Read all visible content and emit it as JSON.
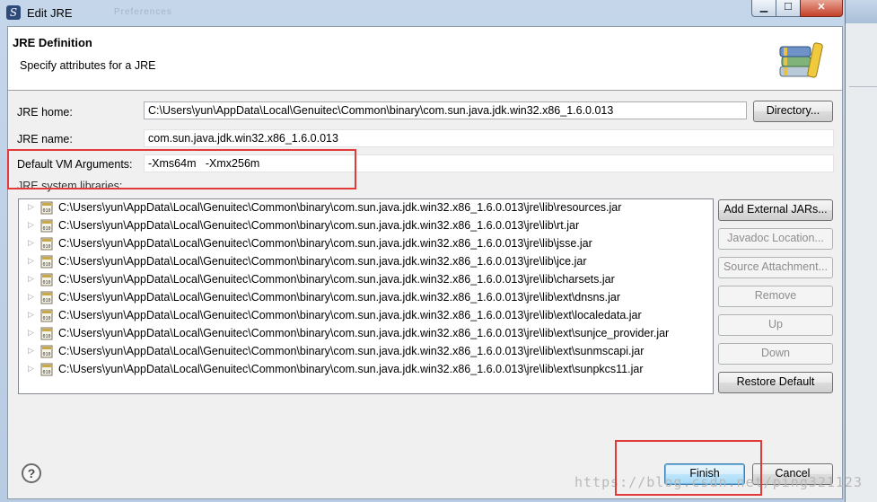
{
  "window": {
    "title": "Edit JRE",
    "background_tab": "Preferences",
    "controls": {
      "minimize": "▁",
      "maximize": "☐",
      "close": "✕"
    }
  },
  "banner": {
    "title": "JRE Definition",
    "description": "Specify attributes for a JRE",
    "icon": "books-icon"
  },
  "form": {
    "jre_home": {
      "label": "JRE home:",
      "value": "C:\\Users\\yun\\AppData\\Local\\Genuitec\\Common\\binary\\com.sun.java.jdk.win32.x86_1.6.0.013"
    },
    "directory_button": "Directory...",
    "jre_name": {
      "label": "JRE name:",
      "value": "com.sun.java.jdk.win32.x86_1.6.0.013"
    },
    "vm_args": {
      "label": "Default VM Arguments:",
      "value": "-Xms64m   -Xmx256m"
    },
    "libraries_label": "JRE system libraries:"
  },
  "libraries": [
    "C:\\Users\\yun\\AppData\\Local\\Genuitec\\Common\\binary\\com.sun.java.jdk.win32.x86_1.6.0.013\\jre\\lib\\resources.jar",
    "C:\\Users\\yun\\AppData\\Local\\Genuitec\\Common\\binary\\com.sun.java.jdk.win32.x86_1.6.0.013\\jre\\lib\\rt.jar",
    "C:\\Users\\yun\\AppData\\Local\\Genuitec\\Common\\binary\\com.sun.java.jdk.win32.x86_1.6.0.013\\jre\\lib\\jsse.jar",
    "C:\\Users\\yun\\AppData\\Local\\Genuitec\\Common\\binary\\com.sun.java.jdk.win32.x86_1.6.0.013\\jre\\lib\\jce.jar",
    "C:\\Users\\yun\\AppData\\Local\\Genuitec\\Common\\binary\\com.sun.java.jdk.win32.x86_1.6.0.013\\jre\\lib\\charsets.jar",
    "C:\\Users\\yun\\AppData\\Local\\Genuitec\\Common\\binary\\com.sun.java.jdk.win32.x86_1.6.0.013\\jre\\lib\\ext\\dnsns.jar",
    "C:\\Users\\yun\\AppData\\Local\\Genuitec\\Common\\binary\\com.sun.java.jdk.win32.x86_1.6.0.013\\jre\\lib\\ext\\localedata.jar",
    "C:\\Users\\yun\\AppData\\Local\\Genuitec\\Common\\binary\\com.sun.java.jdk.win32.x86_1.6.0.013\\jre\\lib\\ext\\sunjce_provider.jar",
    "C:\\Users\\yun\\AppData\\Local\\Genuitec\\Common\\binary\\com.sun.java.jdk.win32.x86_1.6.0.013\\jre\\lib\\ext\\sunmscapi.jar",
    "C:\\Users\\yun\\AppData\\Local\\Genuitec\\Common\\binary\\com.sun.java.jdk.win32.x86_1.6.0.013\\jre\\lib\\ext\\sunpkcs11.jar"
  ],
  "library_buttons": {
    "add_external": "Add External JARs...",
    "javadoc": "Javadoc Location...",
    "source": "Source Attachment...",
    "remove": "Remove",
    "up": "Up",
    "down": "Down",
    "restore": "Restore Default"
  },
  "footer": {
    "help": "?",
    "finish": "Finish",
    "cancel": "Cancel",
    "watermark": "https://blog.csdn.net/ping321123"
  },
  "colors": {
    "highlight": "#e03a3a",
    "titlebar": "#b7cbe2",
    "default_button": "#3c7fb1"
  }
}
